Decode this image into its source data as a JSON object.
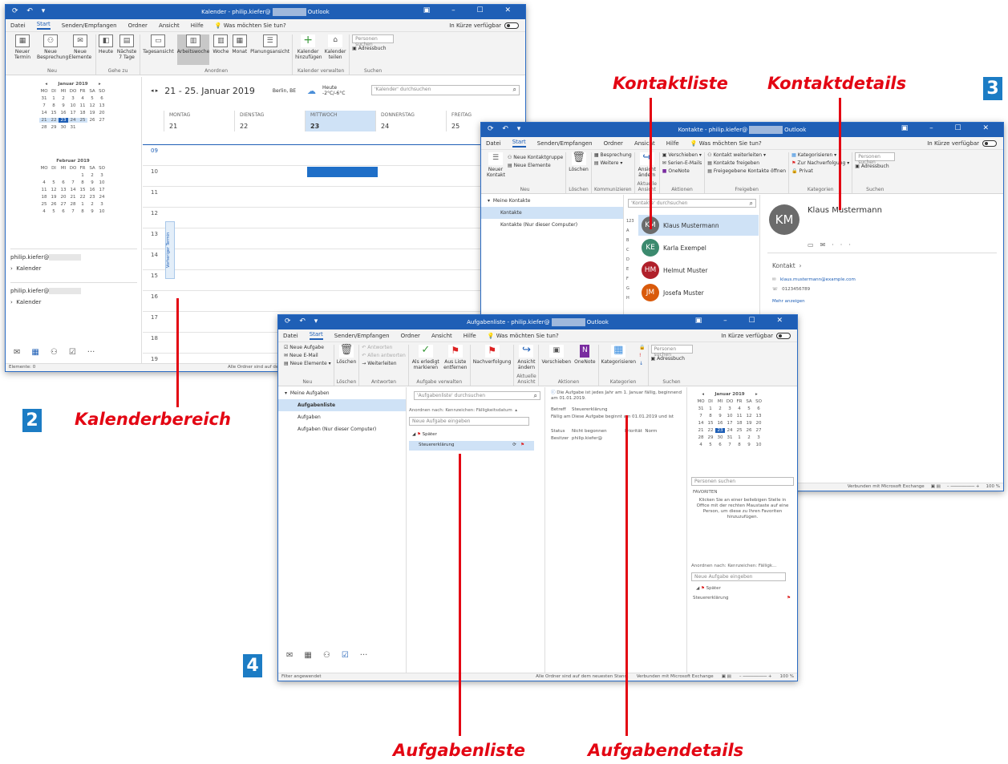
{
  "cal": {
    "title": "Kalender - philip.kiefer@",
    "title_suffix": "Outlook",
    "menus": [
      "Datei",
      "Start",
      "Senden/Empfangen",
      "Ordner",
      "Ansicht",
      "Hilfe"
    ],
    "tell_me": "Was möchten Sie tun?",
    "coming_soon": "In Kürze verfügbar",
    "ribbon": {
      "new_appt": "Neuer Termin",
      "new_meeting": "Neue Besprechung",
      "new_items": "Neue Elemente",
      "today": "Heute",
      "next7": "Nächste 7 Tage",
      "day": "Tagesansicht",
      "work_week": "Arbeitswoche",
      "week": "Woche",
      "month": "Monat",
      "schedule": "Planungsansicht",
      "add_cal": "Kalender hinzufügen",
      "share_cal": "Kalender teilen",
      "search_people": "Personen suchen",
      "address_book": "Adressbuch",
      "g_new": "Neu",
      "g_goto": "Gehe zu",
      "g_arrange": "Anordnen",
      "g_manage": "Kalender verwalten",
      "g_search": "Suchen"
    },
    "jan_title": "Januar 2019",
    "feb_title": "Februar 2019",
    "weekdays": [
      "MO",
      "DI",
      "MI",
      "DO",
      "FR",
      "SA",
      "SO"
    ],
    "jan_days": [
      "31",
      "1",
      "2",
      "3",
      "4",
      "5",
      "6",
      "7",
      "8",
      "9",
      "10",
      "11",
      "12",
      "13",
      "14",
      "15",
      "16",
      "17",
      "18",
      "19",
      "20",
      "21",
      "22",
      "23",
      "24",
      "25",
      "26",
      "27",
      "28",
      "29",
      "30",
      "31",
      "",
      "",
      ""
    ],
    "feb_days": [
      "",
      "",
      "",
      "",
      "1",
      "2",
      "3",
      "4",
      "5",
      "6",
      "7",
      "8",
      "9",
      "10",
      "11",
      "12",
      "13",
      "14",
      "15",
      "16",
      "17",
      "18",
      "19",
      "20",
      "21",
      "22",
      "23",
      "24",
      "25",
      "26",
      "27",
      "28",
      "1",
      "2",
      "3",
      "4",
      "5",
      "6",
      "7",
      "8",
      "9",
      "10"
    ],
    "account1": "philip.kiefer@",
    "cal_item1": "Kalender",
    "account2": "philip.kiefer@",
    "cal_item2": "Kalender",
    "range": "21 - 25. Januar 2019",
    "location": "Berlin, BE",
    "weather_label": "Heute",
    "weather_temp": "-2°C/-6°C",
    "search_ph": "'Kalender' durchsuchen",
    "day_headers": [
      "MONTAG",
      "DIENSTAG",
      "MITTWOCH",
      "DONNERSTAG",
      "FREITAG"
    ],
    "day_nums": [
      "21",
      "22",
      "23",
      "24",
      "25"
    ],
    "hours": [
      "09",
      "10",
      "11",
      "12",
      "13",
      "14",
      "15",
      "16",
      "17",
      "18",
      "19"
    ],
    "prev_appt": "Vorheriger Termin",
    "status_left": "Elemente: 0",
    "status_right": "Alle Ordner sind auf dem neues"
  },
  "contacts": {
    "title": "Kontakte - philip.kiefer@",
    "title_suffix": "Outlook",
    "menus": [
      "Datei",
      "Start",
      "Senden/Empfangen",
      "Ordner",
      "Ansicht",
      "Hilfe"
    ],
    "tell_me": "Was möchten Sie tun?",
    "coming_soon": "In Kürze verfügbar",
    "ribbon": {
      "new_contact": "Neuer Kontakt",
      "new_group": "Neue Kontaktgruppe",
      "new_items": "Neue Elemente",
      "delete": "Löschen",
      "meeting": "Besprechung",
      "more": "Weitere",
      "change_view": "Ansicht ändern",
      "move": "Verschieben",
      "mail_merge": "Serien-E-Mails",
      "onenote": "OneNote",
      "forward": "Kontakt weiterleiten",
      "share": "Kontakte freigeben",
      "open_shared": "Freigegebene Kontakte öffnen",
      "categorize": "Kategorisieren",
      "follow_up": "Zur Nachverfolgung",
      "private": "Privat",
      "search_people": "Personen suchen",
      "address_book": "Adressbuch",
      "g_new": "Neu",
      "g_delete": "Löschen",
      "g_communicate": "Kommunizieren",
      "g_view": "Aktuelle Ansicht",
      "g_actions": "Aktionen",
      "g_share": "Freigeben",
      "g_tags": "Kategorien",
      "g_search": "Suchen"
    },
    "folder_header": "Meine Kontakte",
    "folders": [
      "Kontakte",
      "Kontakte (Nur dieser Computer)"
    ],
    "search_ph": "'Kontakte' durchsuchen",
    "index": [
      "123",
      "A",
      "B",
      "C",
      "D",
      "E",
      "F",
      "G",
      "H"
    ],
    "list": [
      {
        "initials": "KM",
        "name": "Klaus Mustermann",
        "color": "#6b6b6b"
      },
      {
        "initials": "KE",
        "name": "Karla Exempel",
        "color": "#3b8a6e"
      },
      {
        "initials": "HM",
        "name": "Helmut Muster",
        "color": "#b0202a"
      },
      {
        "initials": "JM",
        "name": "Josefa Muster",
        "color": "#d95a0b"
      }
    ],
    "detail_initials": "KM",
    "detail_name": "Klaus Mustermann",
    "detail_section": "Kontakt",
    "email": "klaus.mustermann@example.com",
    "phone": "0123456789",
    "more": "Mehr anzeigen",
    "status_right": "Verbunden mit Microsoft Exchange",
    "zoom": "100 %"
  },
  "tasks": {
    "title": "Aufgabenliste - philip.kiefer@",
    "title_suffix": "Outlook",
    "menus": [
      "Datei",
      "Start",
      "Senden/Empfangen",
      "Ordner",
      "Ansicht",
      "Hilfe"
    ],
    "tell_me": "Was möchten Sie tun?",
    "coming_soon": "In Kürze verfügbar",
    "ribbon": {
      "new_task": "Neue Aufgabe",
      "new_mail": "Neue E-Mail",
      "new_items": "Neue Elemente",
      "delete": "Löschen",
      "reply": "Antworten",
      "reply_all": "Allen antworten",
      "forward": "Weiterleiten",
      "mark_done": "Als erledigt markieren",
      "remove": "Aus Liste entfernen",
      "follow_up": "Nachverfolgung",
      "change_view": "Ansicht ändern",
      "move": "Verschieben",
      "onenote": "OneNote",
      "categorize": "Kategorisieren",
      "search_people": "Personen suchen",
      "address_book": "Adressbuch",
      "g_new": "Neu",
      "g_delete": "Löschen",
      "g_respond": "Antworten",
      "g_manage": "Aufgabe verwalten",
      "g_view": "Aktuelle Ansicht",
      "g_actions": "Aktionen",
      "g_tags": "Kategorien",
      "g_search": "Suchen"
    },
    "folder_header": "Meine Aufgaben",
    "folders": [
      "Aufgabenliste",
      "Aufgaben",
      "Aufgaben (Nur dieser Computer)"
    ],
    "search_ph": "'Aufgabenliste' durchsuchen",
    "arrange": "Anordnen nach: Kennzeichen: Fälligkeitsdatum",
    "new_task_ph": "Neue Aufgabe eingeben",
    "group": "Später",
    "task_item": "Steuererklärung",
    "info": "Die Aufgabe ist jedes Jahr am 1. Januar fällig, beginnend am 01.01.2019.",
    "subject_label": "Betreff",
    "subject": "Steuererklärung",
    "due_label": "Fällig am",
    "due": "Diese Aufgabe beginnt am 01.01.2019 und ist",
    "status_label": "Status",
    "status": "Nicht begonnen",
    "priority_label": "Priorität",
    "priority": "Norm",
    "owner_label": "Besitzer",
    "owner": "philip.kiefer@",
    "jan_title": "Januar 2019",
    "weekdays": [
      "MO",
      "DI",
      "MI",
      "DO",
      "FR",
      "SA",
      "SO"
    ],
    "days": [
      "31",
      "1",
      "2",
      "3",
      "4",
      "5",
      "6",
      "7",
      "8",
      "9",
      "10",
      "11",
      "12",
      "13",
      "14",
      "15",
      "16",
      "17",
      "18",
      "19",
      "20",
      "21",
      "22",
      "23",
      "24",
      "25",
      "26",
      "27",
      "28",
      "29",
      "30",
      "31",
      "1",
      "2",
      "3",
      "4",
      "5",
      "6",
      "7",
      "8",
      "9",
      "10"
    ],
    "people_search": "Personen suchen",
    "favorites": "FAVORITEN",
    "fav_text": "Klicken Sie an einer beliebigen Stelle in Office mit der rechten Maustaste auf eine Person, um diese zu Ihren Favoriten hinzuzufügen.",
    "arrange2": "Anordnen nach: Kennzeichen: Fälligk...",
    "new_task_ph2": "Neue Aufgabe eingeben",
    "group2": "Später",
    "task_item2": "Steuererklärung",
    "status_left": "Filter angewendet",
    "status_mid": "Alle Ordner sind auf dem neuesten Stand.",
    "status_right": "Verbunden mit Microsoft Exchange",
    "zoom": "100 %"
  },
  "callouts": {
    "contact_list": "Kontaktliste",
    "contact_details": "Kontaktdetails",
    "calendar_area": "Kalenderbereich",
    "task_list": "Aufgabenliste",
    "task_details": "Aufgabendetails",
    "n2": "2",
    "n3": "3",
    "n4": "4"
  },
  "colors": {
    "title_bar": "#1f5fb6",
    "callout_red": "#e30613",
    "number_box": "#1c7cc4"
  }
}
